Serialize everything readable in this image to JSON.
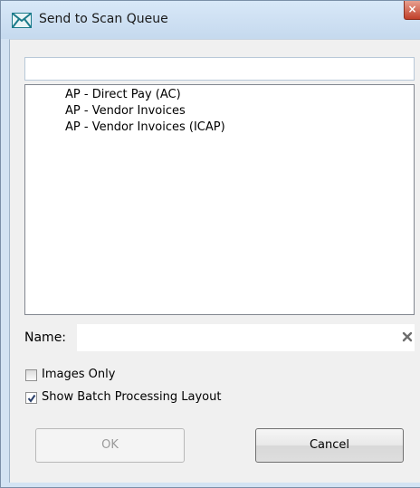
{
  "window": {
    "title": "Send to Scan Queue",
    "close_glyph": "×",
    "icon": "envelope-icon"
  },
  "search": {
    "value": "",
    "placeholder": ""
  },
  "queues": {
    "items": [
      "AP - Direct Pay (AC)",
      "AP - Vendor Invoices",
      "AP - Vendor Invoices (ICAP)"
    ]
  },
  "name_field": {
    "label": "Name:",
    "value": "",
    "clear_icon": "clear-x-icon"
  },
  "options": {
    "images_only": {
      "label": "Images Only",
      "checked": false
    },
    "show_batch_layout": {
      "label": "Show Batch Processing Layout",
      "checked": true
    }
  },
  "buttons": {
    "ok": {
      "label": "OK",
      "enabled": false
    },
    "cancel": {
      "label": "Cancel",
      "enabled": true
    }
  },
  "colors": {
    "titlebar": "#c5d9ee",
    "dialog_bg": "#f0f0f0",
    "close_button": "#c0402a",
    "icon_teal": "#1a7a8a"
  }
}
